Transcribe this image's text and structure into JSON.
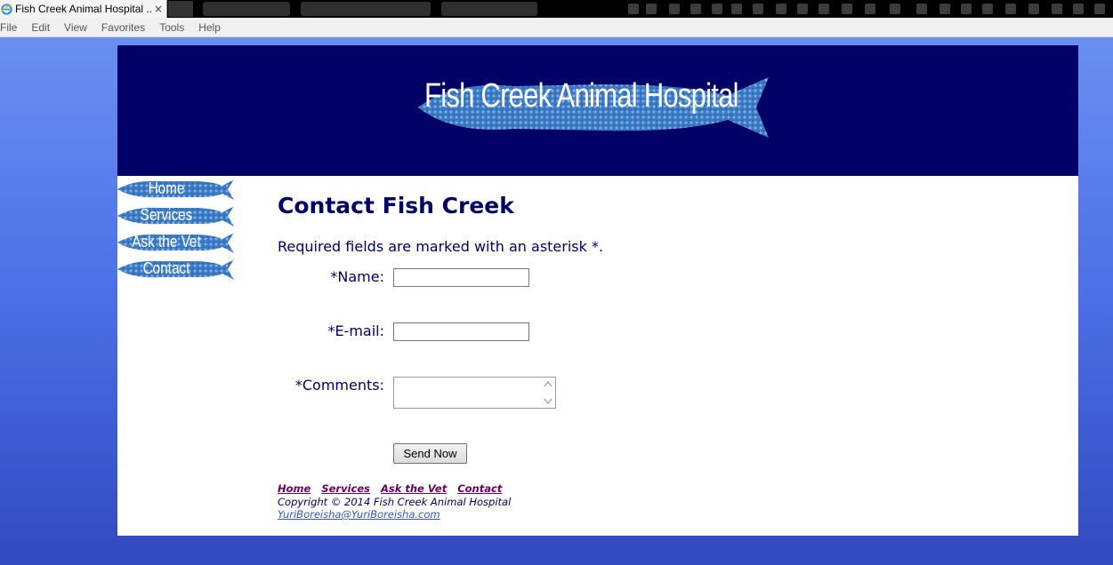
{
  "browser": {
    "tab_title": "Fish Creek Animal Hospital ...",
    "tab_close": "×",
    "menu": [
      "File",
      "Edit",
      "View",
      "Favorites",
      "Tools",
      "Help"
    ]
  },
  "site": {
    "title": "Fish Creek Animal Hospital",
    "nav": [
      "Home",
      "Services",
      "Ask the Vet",
      "Contact"
    ]
  },
  "main": {
    "heading": "Contact Fish Creek",
    "required_note": "Required fields are marked with an asterisk *.",
    "form": {
      "name_label": "*Name:",
      "email_label": "*E-mail:",
      "comments_label": "*Comments:",
      "name_value": "",
      "email_value": "",
      "comments_value": "",
      "submit_label": "Send Now"
    }
  },
  "footer": {
    "links": [
      "Home",
      "Services",
      "Ask the Vet",
      "Contact"
    ],
    "copyright": "Copyright © 2014 Fish Creek Animal Hospital",
    "email": "YuriBoreisha@YuriBoreisha.com"
  },
  "colors": {
    "header_bg": "#000066",
    "text": "#000066",
    "link": "#660066",
    "fish": "#3a78c2"
  }
}
